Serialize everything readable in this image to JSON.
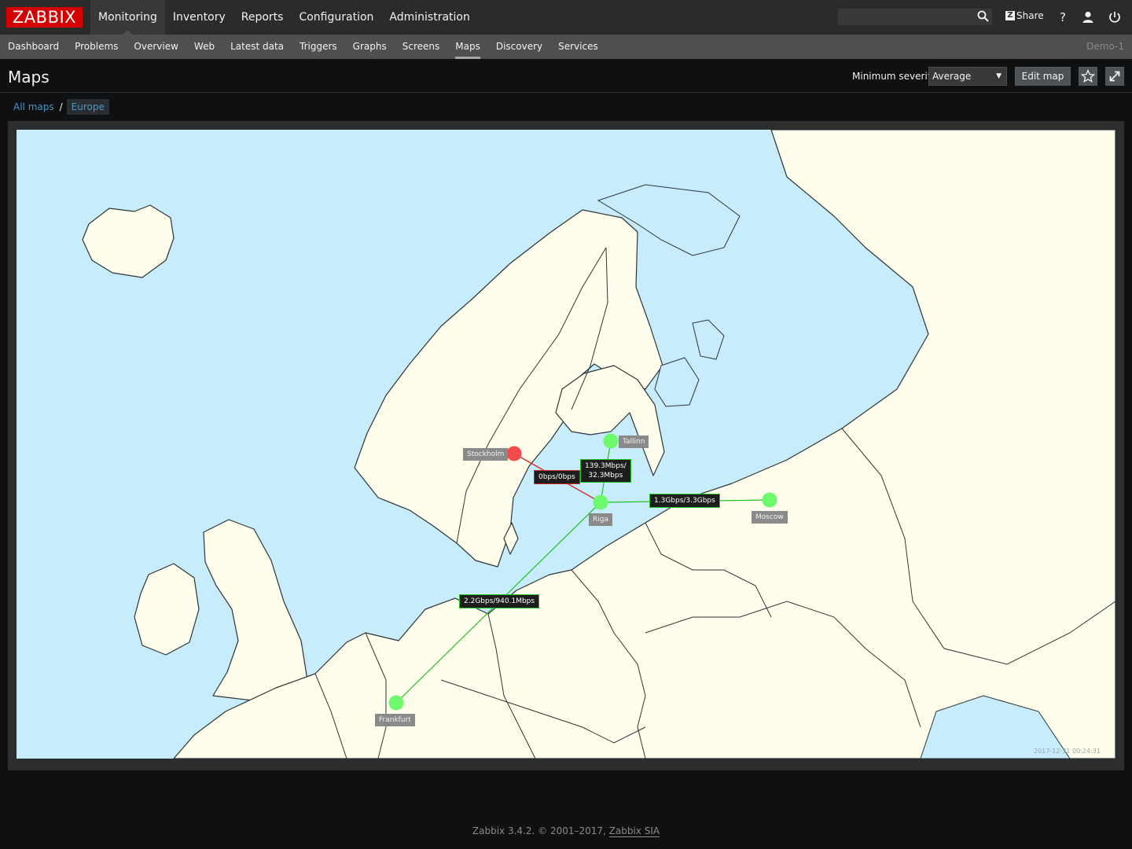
{
  "brand": {
    "logo": "ZABBIX"
  },
  "main_nav": [
    {
      "label": "Monitoring",
      "active": true
    },
    {
      "label": "Inventory"
    },
    {
      "label": "Reports"
    },
    {
      "label": "Configuration"
    },
    {
      "label": "Administration"
    }
  ],
  "topbar": {
    "search_value": "",
    "share_label": "Share",
    "help_glyph": "?"
  },
  "sub_nav": [
    {
      "label": "Dashboard"
    },
    {
      "label": "Problems"
    },
    {
      "label": "Overview"
    },
    {
      "label": "Web"
    },
    {
      "label": "Latest data"
    },
    {
      "label": "Triggers"
    },
    {
      "label": "Graphs"
    },
    {
      "label": "Screens"
    },
    {
      "label": "Maps",
      "active": true
    },
    {
      "label": "Discovery"
    },
    {
      "label": "Services"
    }
  ],
  "server_name": "Demo-1",
  "page": {
    "title": "Maps",
    "min_severity_label": "Minimum severity",
    "min_severity_value": "Average",
    "edit_button": "Edit map"
  },
  "breadcrumb": {
    "all_maps": "All maps",
    "separator": "/",
    "current": "Europe"
  },
  "map": {
    "nodes": {
      "stockholm": {
        "label": "Stockholm",
        "status": "problem"
      },
      "tallinn": {
        "label": "Tallinn",
        "status": "ok"
      },
      "riga": {
        "label": "Riga",
        "status": "ok"
      },
      "moscow": {
        "label": "Moscow",
        "status": "ok"
      },
      "frankfurt": {
        "label": "Frankfurt",
        "status": "ok"
      }
    },
    "links": {
      "stockholm_riga": {
        "line1": "0bps/0bps",
        "color": "#d42a2a"
      },
      "tallinn_riga": {
        "line1": "139.3Mbps/",
        "line2": "32.3Mbps",
        "color": "#22c322"
      },
      "riga_moscow": {
        "line1": "1.3Gbps/3.3Gbps",
        "color": "#22c322"
      },
      "riga_frankfurt": {
        "line1": "2.2Gbps/940.1Mbps",
        "color": "#22c322"
      }
    },
    "timestamp": "2017-12-31 00:24:31",
    "colors": {
      "sea": "#c7ecfc",
      "land": "#fffdeb",
      "ok": "#6dfa6d",
      "problem": "#f24b4b"
    }
  },
  "footer": {
    "version": "Zabbix 3.4.2. © 2001–2017, ",
    "company": "Zabbix SIA"
  }
}
